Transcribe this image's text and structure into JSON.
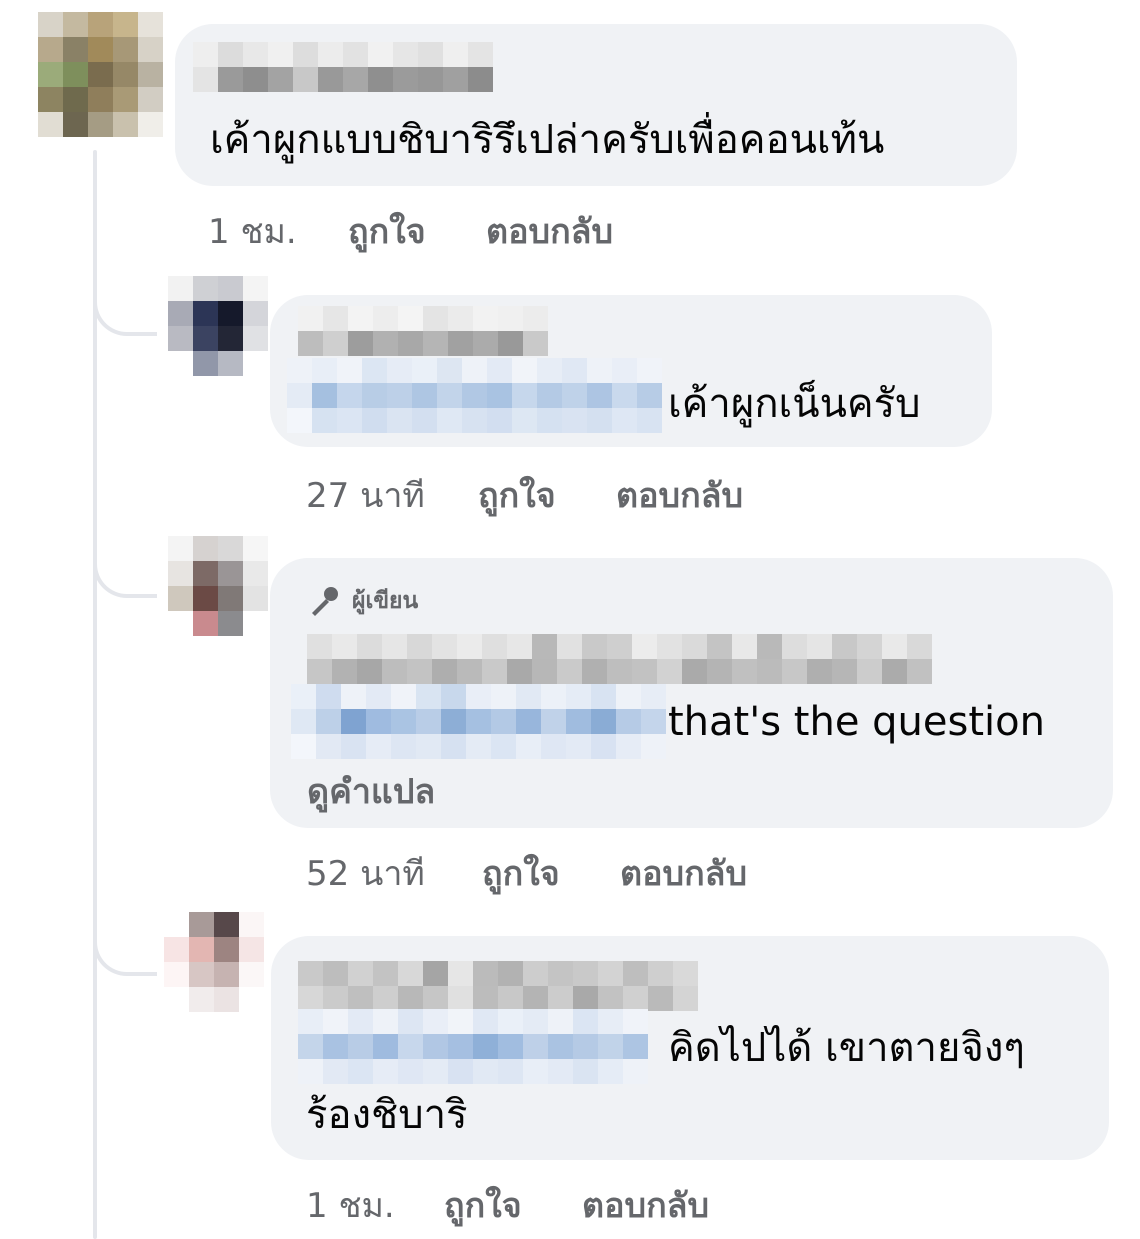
{
  "comments": [
    {
      "text": "เค้าผูกแบบชิบาริรึเปล่าครับเพื่อคอนเท้น",
      "time": "1 ชม.",
      "like": "ถูกใจ",
      "reply": "ตอบกลับ"
    },
    {
      "text": "เค้าผูกเน็นครับ",
      "time": "27 นาที",
      "like": "ถูกใจ",
      "reply": "ตอบกลับ"
    },
    {
      "author_badge": "ผู้เขียน",
      "text": "that's the question",
      "see_translation": "ดูคำแปล",
      "time": "52 นาที",
      "like": "ถูกใจ",
      "reply": "ตอบกลับ"
    },
    {
      "text_line1": "คิดไปได้ เขาตายจิงๆ",
      "text_line2": "ร้องชิบาริ",
      "time": "1 ชม.",
      "like": "ถูกใจ",
      "reply": "ตอบกลับ"
    }
  ],
  "icons": {
    "author_badge": "microphone-icon"
  },
  "colors": {
    "bubble": "#f0f2f5",
    "meta_text": "#65676b",
    "thread_line": "#e4e6eb",
    "mention_blur": "#a9c0de"
  }
}
